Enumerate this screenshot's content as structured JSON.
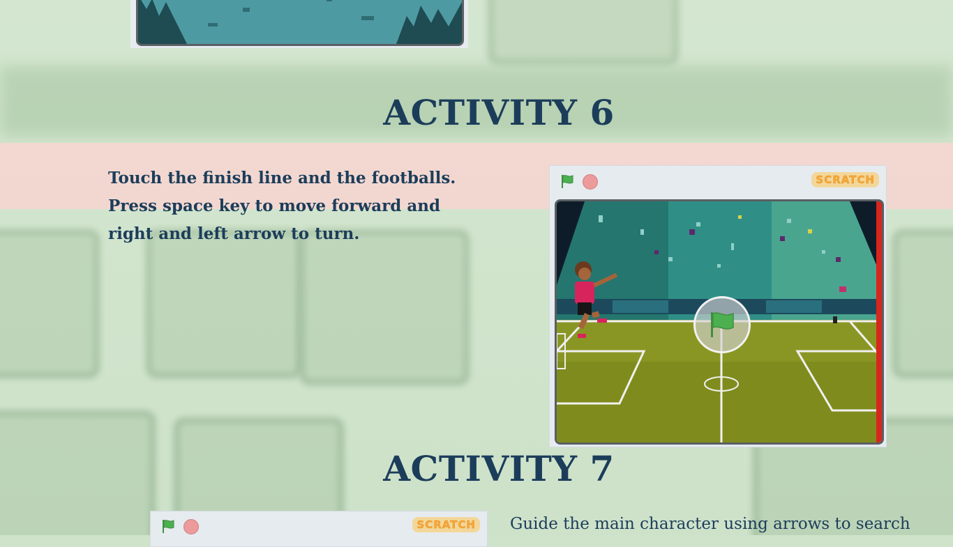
{
  "activity6": {
    "heading": "ACTIVITY 6",
    "description": "Touch the finish line and the footballs. Press space key to move forward and right and left arrow to turn.",
    "player_logo": "SCRATCH"
  },
  "activity7": {
    "heading": "ACTIVITY 7",
    "description": "Guide the main character using arrows to search",
    "player_logo": "SCRATCH"
  },
  "icons": {
    "green_flag": "green-flag-icon",
    "stop": "stop-icon",
    "big_start": "green-flag-icon"
  },
  "colors": {
    "heading": "#1c3d5a",
    "flag_green": "#4cb050",
    "stop_red": "#ec9a9a",
    "pink_band": "#fdd0cf",
    "background": "#cfe3cb"
  }
}
